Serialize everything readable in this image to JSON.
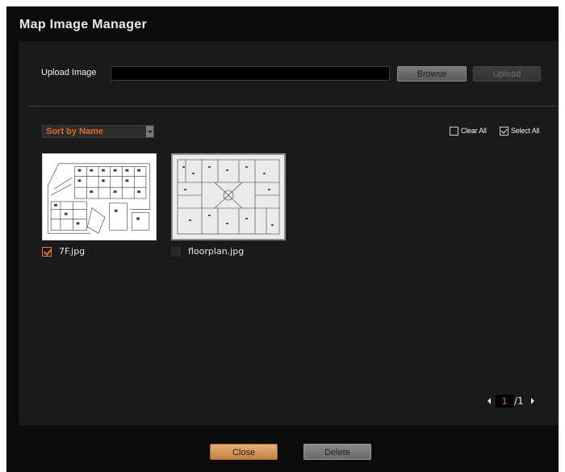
{
  "dialog": {
    "title": "Map Image Manager"
  },
  "upload": {
    "label": "Upload Image",
    "path_value": "",
    "browse_label": "Browse",
    "upload_label": "Upload"
  },
  "sort": {
    "selected": "Sort by Name"
  },
  "selection": {
    "clear_all_label": "Clear All",
    "select_all_label": "Select All"
  },
  "images": [
    {
      "name": "7F.jpg",
      "checked": true
    },
    {
      "name": "floorplan.jpg",
      "checked": false
    }
  ],
  "pagination": {
    "current": "1",
    "total_label": "/1"
  },
  "footer": {
    "close_label": "Close",
    "delete_label": "Delete"
  },
  "colors": {
    "accent": "#e07a2a",
    "background": "#0b0b0b",
    "panel": "#1a1a1a"
  },
  "icons": [
    "dropdown-arrow-icon",
    "checkbox-icon",
    "prev-page-icon",
    "next-page-icon"
  ]
}
